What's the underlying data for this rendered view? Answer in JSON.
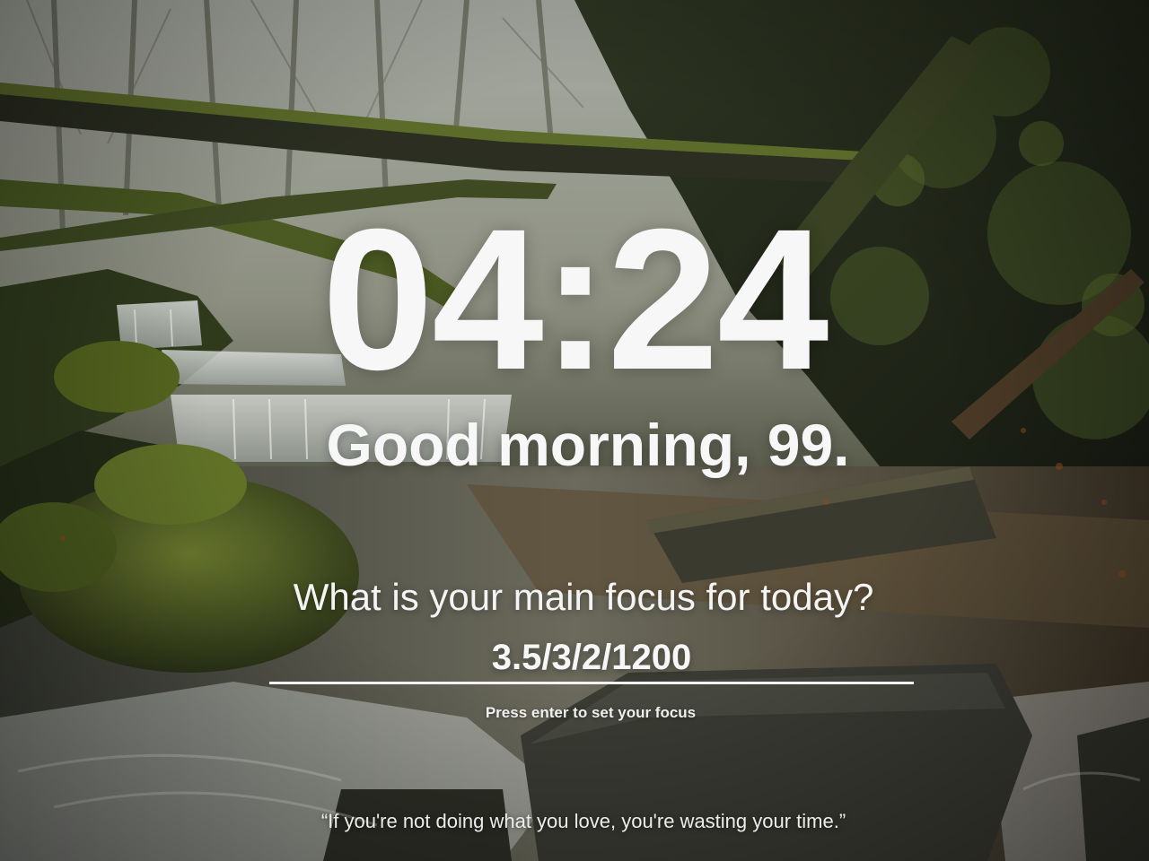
{
  "clock": {
    "time": "04:24"
  },
  "greeting": {
    "text": "Good morning, 99."
  },
  "focus": {
    "question": "What is your main focus for today?",
    "input_value": "3.5/3/2/1200",
    "hint": "Press enter to set your focus"
  },
  "quote": {
    "text": "“If you're not doing what you love, you're wasting your time.”"
  },
  "background": {
    "description_icon": "forest-stream-photo",
    "colors": {
      "mist": "#b9bbb1",
      "moss": "#4f5a2a",
      "deep_forest": "#1f2618",
      "water": "#c9ccc9",
      "rock": "#3a3b34"
    }
  }
}
